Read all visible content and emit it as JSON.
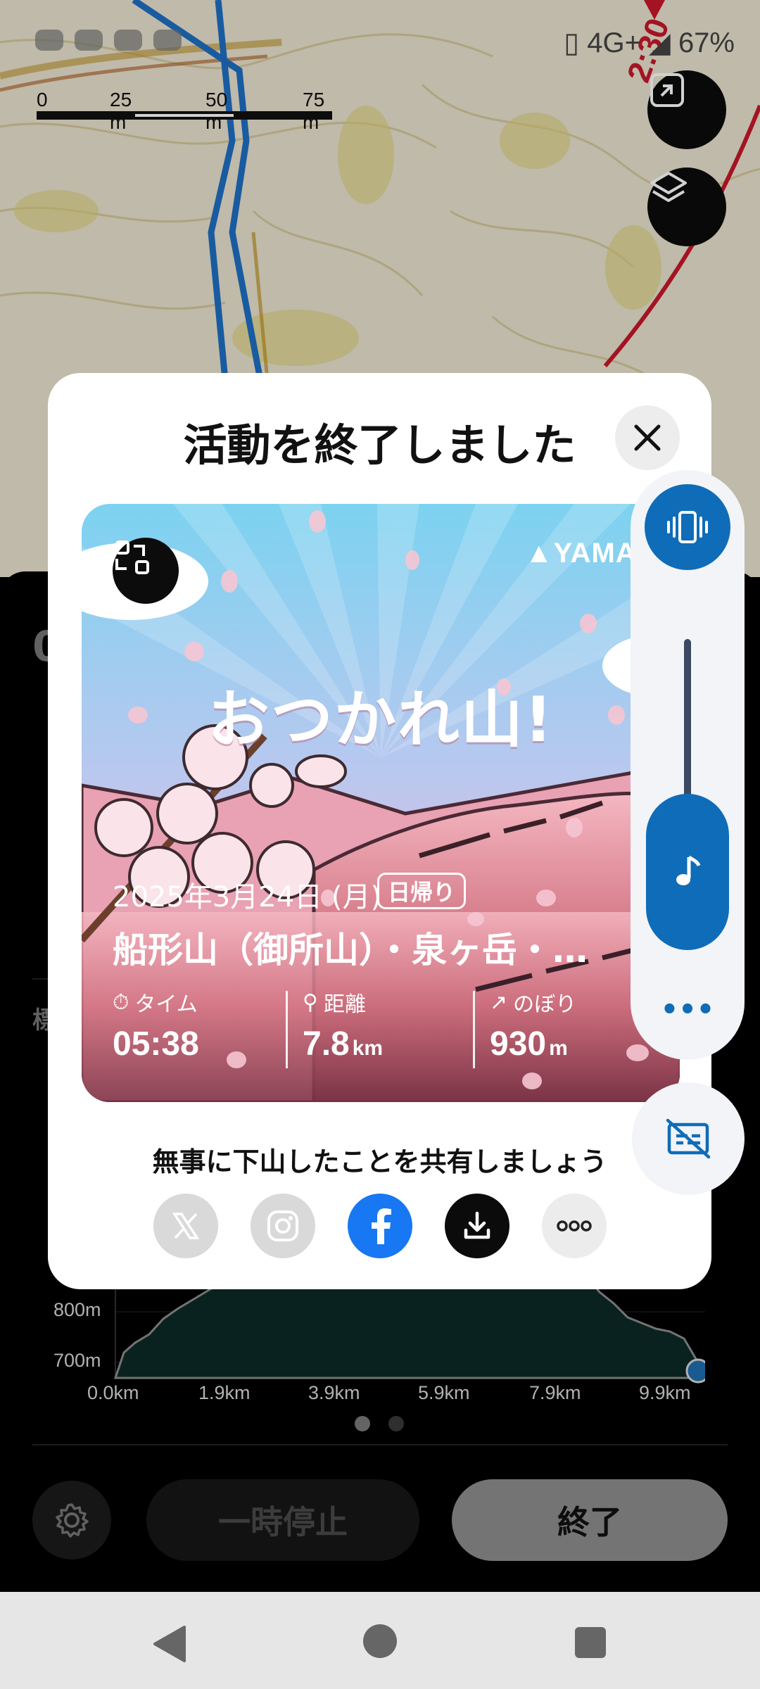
{
  "status_bar": {
    "network": "4G+",
    "battery": "67%"
  },
  "map": {
    "scale_labels": [
      "0",
      "25 m",
      "50 m",
      "75 m"
    ],
    "route_time_label": "2:30"
  },
  "panel": {
    "partial_heading": "0",
    "partial_label": "標",
    "elevation_chart": {
      "y_ticks": [
        "800m",
        "700m"
      ],
      "x_ticks": [
        "0.0km",
        "1.9km",
        "3.9km",
        "5.9km",
        "7.9km",
        "9.9km"
      ]
    },
    "page_indicator": {
      "count": 2,
      "active": 0
    },
    "pause_label": "一時停止",
    "end_label": "終了"
  },
  "modal": {
    "title": "活動を終了しました",
    "card": {
      "brand": "YAMA",
      "headline": "おつかれ山!",
      "date": "2025年3月24日 (月)",
      "badge": "日帰り",
      "mountains": "船形山（御所山）・泉ヶ岳・…",
      "stats": [
        {
          "label": "タイム",
          "value": "05:38",
          "unit": ""
        },
        {
          "label": "距離",
          "value": "7.8",
          "unit": "km"
        },
        {
          "label": "のぼり",
          "value": "930",
          "unit": "m"
        }
      ]
    },
    "share_prompt": "無事に下山したことを共有しましょう",
    "share_buttons": [
      "x-icon",
      "instagram-icon",
      "facebook-icon",
      "download-icon",
      "more-icon"
    ]
  },
  "colors": {
    "accent": "#0f6cb8",
    "facebook": "#1877f2"
  }
}
